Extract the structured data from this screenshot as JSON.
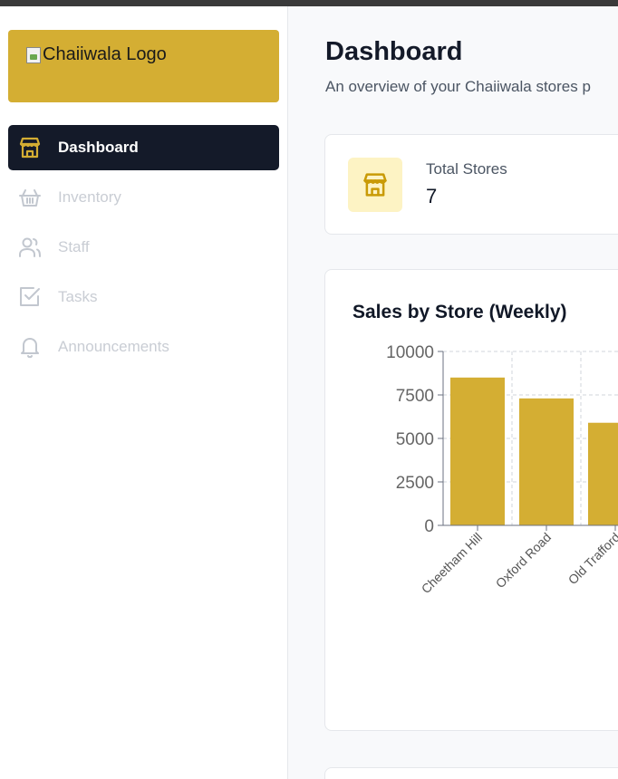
{
  "sidebar": {
    "logo_alt": "Chaiiwala Logo",
    "items": [
      {
        "label": "Dashboard",
        "icon": "store-icon",
        "active": true
      },
      {
        "label": "Inventory",
        "icon": "basket-icon",
        "active": false
      },
      {
        "label": "Staff",
        "icon": "users-icon",
        "active": false
      },
      {
        "label": "Tasks",
        "icon": "checkbox-icon",
        "active": false
      },
      {
        "label": "Announcements",
        "icon": "bell-icon",
        "active": false
      }
    ]
  },
  "header": {
    "title": "Dashboard",
    "subtitle": "An overview of your Chaiiwala stores p"
  },
  "stats": {
    "total_stores_label": "Total Stores",
    "total_stores_value": "7",
    "icon": "store-icon"
  },
  "chart_title": "Sales by Store (Weekly)",
  "colors": {
    "brand": "#d4ae33",
    "active_nav": "#141a29",
    "stat_icon_bg": "#fdf3c4",
    "stat_icon": "#c99a06"
  },
  "chart_data": {
    "type": "bar",
    "title": "Sales by Store (Weekly)",
    "categories": [
      "Cheetham Hill",
      "Oxford Road",
      "Old Trafford"
    ],
    "values": [
      8500,
      7300,
      5900
    ],
    "ylim": [
      0,
      10000
    ],
    "yticks": [
      "0",
      "2500",
      "5000",
      "7500",
      "10000"
    ],
    "grid": true,
    "xlabel": "",
    "ylabel": ""
  }
}
